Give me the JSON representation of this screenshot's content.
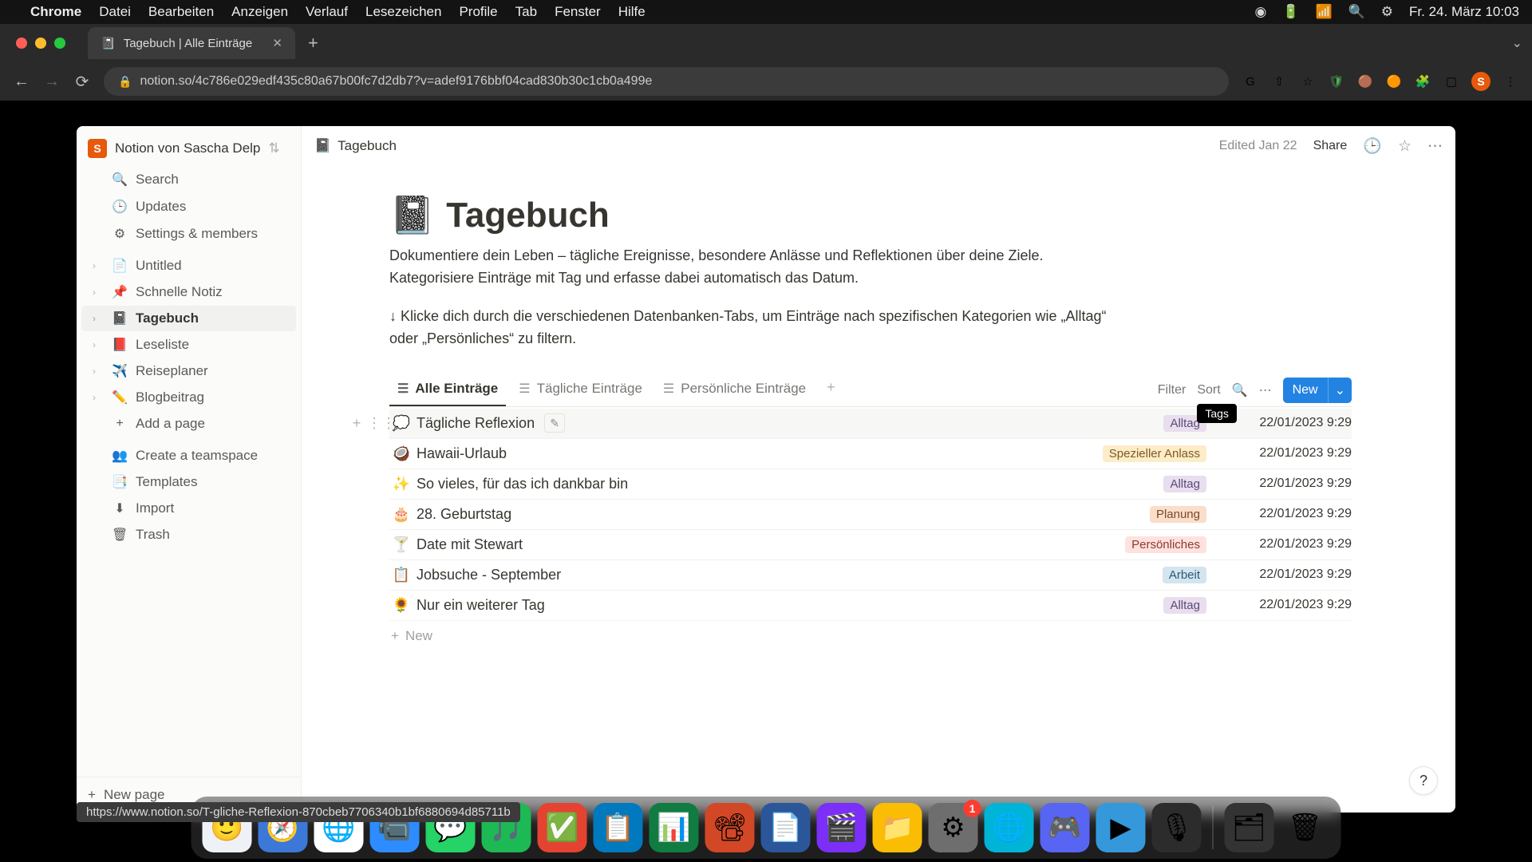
{
  "menubar": {
    "app": "Chrome",
    "items": [
      "Datei",
      "Bearbeiten",
      "Anzeigen",
      "Verlauf",
      "Lesezeichen",
      "Profile",
      "Tab",
      "Fenster",
      "Hilfe"
    ],
    "clock": "Fr. 24. März  10:03"
  },
  "browser": {
    "tab_title": "Tagebuch | Alle Einträge",
    "url": "notion.so/4c786e029edf435c80a67b00fc7d2db7?v=adef9176bbf04cad830b30c1cb0a499e",
    "status_url": "https://www.notion.so/T-gliche-Reflexion-870cbeb7706340b1bf6880694d85711b",
    "avatar_letter": "S"
  },
  "sidebar": {
    "workspace": "Notion von Sascha Delp",
    "avatar_letter": "S",
    "nav": {
      "search": "Search",
      "updates": "Updates",
      "settings": "Settings & members"
    },
    "pages": [
      {
        "emoji": "📄",
        "label": "Untitled"
      },
      {
        "emoji": "📌",
        "label": "Schnelle Notiz"
      },
      {
        "emoji": "📓",
        "label": "Tagebuch",
        "active": true
      },
      {
        "emoji": "📕",
        "label": "Leseliste"
      },
      {
        "emoji": "✈️",
        "label": "Reiseplaner"
      },
      {
        "emoji": "✏️",
        "label": "Blogbeitrag"
      }
    ],
    "add_page": "Add a page",
    "teamspace": "Create a teamspace",
    "templates": "Templates",
    "import": "Import",
    "trash": "Trash",
    "new_page": "New page"
  },
  "topbar": {
    "breadcrumb_emoji": "📓",
    "breadcrumb": "Tagebuch",
    "edited": "Edited Jan 22",
    "share": "Share"
  },
  "page": {
    "emoji": "📓",
    "title": "Tagebuch",
    "desc1": "Dokumentiere dein Leben – tägliche Ereignisse, besondere Anlässe und Reflektionen über deine Ziele. Kategorisiere Einträge mit Tag und erfasse dabei automatisch das Datum.",
    "desc2": "↓ Klicke dich durch die verschiedenen Datenbanken-Tabs, um Einträge nach spezifischen Kategorien wie „Alltag“ oder „Persönliches“ zu filtern."
  },
  "db": {
    "tabs": [
      {
        "label": "Alle Einträge",
        "active": true
      },
      {
        "label": "Tägliche Einträge"
      },
      {
        "label": "Persönliche Einträge"
      }
    ],
    "tools": {
      "filter": "Filter",
      "sort": "Sort",
      "tooltip": "Tags",
      "new": "New"
    },
    "rows": [
      {
        "emoji": "💭",
        "title": "Tägliche Reflexion",
        "tag": "Alltag",
        "tag_class": "alltag",
        "date": "22/01/2023 9:29",
        "hovered": true
      },
      {
        "emoji": "🥥",
        "title": "Hawaii-Urlaub",
        "tag": "Spezieller Anlass",
        "tag_class": "spezieller",
        "date": "22/01/2023 9:29"
      },
      {
        "emoji": "✨",
        "title": "So vieles, für das ich dankbar bin",
        "tag": "Alltag",
        "tag_class": "alltag",
        "date": "22/01/2023 9:29"
      },
      {
        "emoji": "🎂",
        "title": "28. Geburtstag",
        "tag": "Planung",
        "tag_class": "planung",
        "date": "22/01/2023 9:29"
      },
      {
        "emoji": "🍸",
        "title": "Date mit Stewart",
        "tag": "Persönliches",
        "tag_class": "persoenliches",
        "date": "22/01/2023 9:29"
      },
      {
        "emoji": "📋",
        "title": "Jobsuche - September",
        "tag": "Arbeit",
        "tag_class": "arbeit",
        "date": "22/01/2023 9:29"
      },
      {
        "emoji": "🌻",
        "title": "Nur ein weiterer Tag",
        "tag": "Alltag",
        "tag_class": "alltag",
        "date": "22/01/2023 9:29"
      }
    ],
    "new_row": "New"
  },
  "dock": {
    "apps": [
      {
        "color": "#eef2f6",
        "icon": "🙂"
      },
      {
        "color": "#3c78d8",
        "icon": "🧭"
      },
      {
        "color": "#fff",
        "icon": "🌐"
      },
      {
        "color": "#2d8cff",
        "icon": "📹"
      },
      {
        "color": "#25d366",
        "icon": "💬"
      },
      {
        "color": "#1db954",
        "icon": "🎵"
      },
      {
        "color": "#e44332",
        "icon": "✅"
      },
      {
        "color": "#0079bf",
        "icon": "📋"
      },
      {
        "color": "#107c41",
        "icon": "📊"
      },
      {
        "color": "#d24726",
        "icon": "📽"
      },
      {
        "color": "#2b579a",
        "icon": "📄"
      },
      {
        "color": "#7b2ff7",
        "icon": "🎬"
      },
      {
        "color": "#fbbc04",
        "icon": "📁"
      },
      {
        "color": "#6e6e6e",
        "icon": "⚙",
        "badge": "1"
      },
      {
        "color": "#00b4d8",
        "icon": "🌐"
      },
      {
        "color": "#5865f2",
        "icon": "🎮"
      },
      {
        "color": "#3498db",
        "icon": "▶"
      },
      {
        "color": "#2c2c2c",
        "icon": "🎙"
      }
    ],
    "trash_icon": "🗑"
  }
}
